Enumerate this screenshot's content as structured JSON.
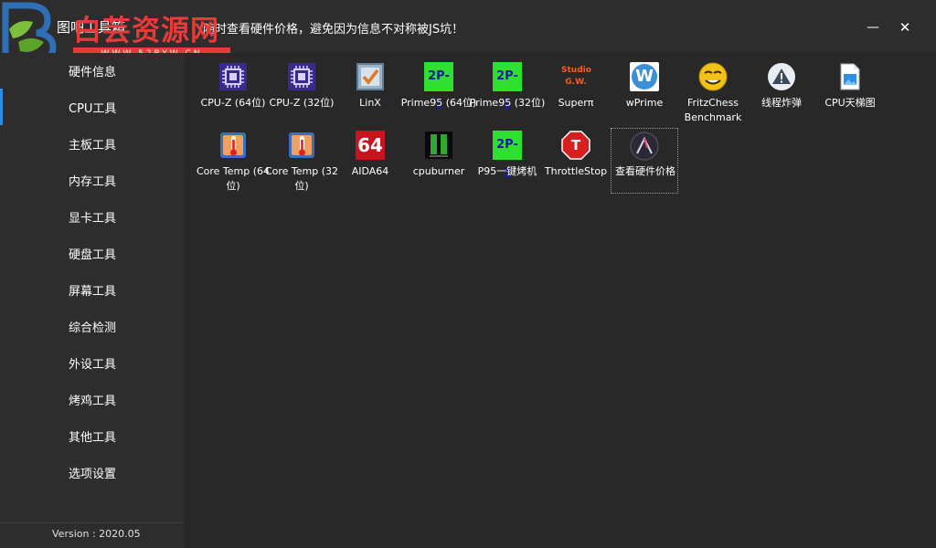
{
  "window": {
    "title": "图吧工具箱",
    "tip": "随时查看硬件价格，避免因为信息不对称被JS坑！",
    "minimize_glyph": "—",
    "close_glyph": "✕"
  },
  "watermark": {
    "text": "白芸资源网",
    "url": "WWW.52BYW.CN",
    "colors": {
      "red": "#e63b3b",
      "blue": "#2f6fb5",
      "green": "#7cbf3a"
    }
  },
  "sidebar": {
    "items": [
      {
        "label": "硬件信息",
        "active": false
      },
      {
        "label": "CPU工具",
        "active": true
      },
      {
        "label": "主板工具",
        "active": false
      },
      {
        "label": "内存工具",
        "active": false
      },
      {
        "label": "显卡工具",
        "active": false
      },
      {
        "label": "硬盘工具",
        "active": false
      },
      {
        "label": "屏幕工具",
        "active": false
      },
      {
        "label": "综合检测",
        "active": false
      },
      {
        "label": "外设工具",
        "active": false
      },
      {
        "label": "烤鸡工具",
        "active": false
      },
      {
        "label": "其他工具",
        "active": false
      },
      {
        "label": "选项设置",
        "active": false
      }
    ],
    "version": "Version : 2020.05",
    "accent": "#2f8de6"
  },
  "tools": [
    {
      "label": "CPU-Z (64位)",
      "icon": "cpu-z-chip-icon"
    },
    {
      "label": "CPU-Z (32位)",
      "icon": "cpu-z-chip-icon"
    },
    {
      "label": "LinX",
      "icon": "linx-checkbox-icon"
    },
    {
      "label": "Prime95 (64位)",
      "icon": "prime95-icon",
      "icon_text": "2P-1"
    },
    {
      "label": "Prime95 (32位)",
      "icon": "prime95-icon",
      "icon_text": "2P-1"
    },
    {
      "label": "Superπ",
      "icon": "superpi-icon",
      "icon_text": "Studio G.W."
    },
    {
      "label": "wPrime",
      "icon": "wprime-icon",
      "icon_text": "W"
    },
    {
      "label": "FritzChess Benchmark",
      "icon": "fritz-smiley-icon"
    },
    {
      "label": "线程炸弹",
      "icon": "warning-icon"
    },
    {
      "label": "CPU天梯图",
      "icon": "image-file-icon"
    },
    {
      "label": "Core Temp (64位)",
      "icon": "thermometer-icon"
    },
    {
      "label": "Core Temp (32位)",
      "icon": "thermometer-icon"
    },
    {
      "label": "AIDA64",
      "icon": "aida64-icon",
      "icon_text": "64"
    },
    {
      "label": "cpuburner",
      "icon": "cpuburner-icon"
    },
    {
      "label": "P95一键烤机",
      "icon": "prime95-icon",
      "icon_text": "2P-1"
    },
    {
      "label": "ThrottleStop",
      "icon": "throttlestop-icon",
      "icon_text": "T"
    },
    {
      "label": "查看硬件价格",
      "icon": "price-gauge-icon",
      "selected": true
    }
  ]
}
